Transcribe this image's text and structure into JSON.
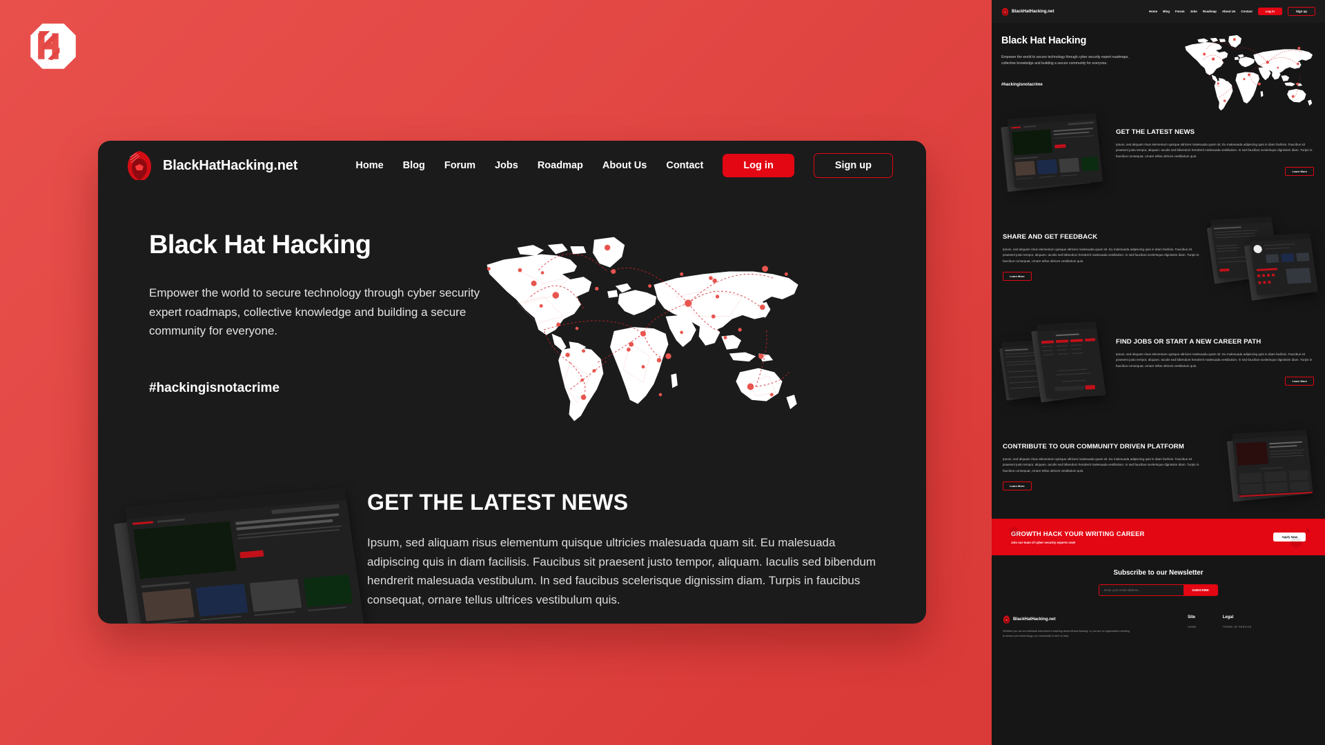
{
  "brand": {
    "logo_mark": "hh-monogram-logo",
    "name": "BlackHatHacking.net"
  },
  "nav": {
    "links": [
      "Home",
      "Blog",
      "Forum",
      "Jobs",
      "Roadmap",
      "About Us",
      "Contact"
    ],
    "login_label": "Log in",
    "signup_label": "Sign up"
  },
  "hero": {
    "title": "Black Hat Hacking",
    "subtitle": "Empower the world to secure technology through cyber security expert roadmaps, collective knowledge and building a secure community for everyone.",
    "hashtag": "#hackingisnotacrime",
    "map_alt": "world-connection-map"
  },
  "sections": [
    {
      "title": "GET THE LATEST NEWS",
      "body": "Ipsum, sed aliquam risus elementum quisque ultricies malesuada quam sit. Eu malesuada adipiscing quis in diam facilisis. Faucibus sit praesent justo tempor, aliquam. Iaculis sed bibendum hendrerit malesuada vestibulum. In sed faucibus scelerisque dignissim diam. Turpis in faucibus consequat, ornare tellus ultrices vestibulum quis.",
      "cta": "Learn More",
      "image_side": "left"
    },
    {
      "title": "SHARE AND GET FEEDBACK",
      "body": "Ipsum, sed aliquam risus elementum quisque ultricies malesuada quam sit. Eu malesuada adipiscing quis in diam facilisis. Faucibus sit praesent justo tempor, aliquam. Iaculis sed bibendum hendrerit malesuada vestibulum. In sed faucibus scelerisque dignissim diam. Turpis in faucibus consequat, ornare tellus ultrices vestibulum quis.",
      "cta": "Learn More",
      "image_side": "right"
    },
    {
      "title": "FIND JOBS OR START A NEW CAREER PATH",
      "body": "Ipsum, sed aliquam risus elementum quisque ultricies malesuada quam sit. Eu malesuada adipiscing quis in diam facilisis. Faucibus sit praesent justo tempor, aliquam. Iaculis sed bibendum hendrerit malesuada vestibulum. In sed faucibus scelerisque dignissim diam. Turpis in faucibus consequat, ornare tellus ultrices vestibulum quis.",
      "cta": "Learn More",
      "image_side": "left"
    },
    {
      "title": "CONTRIBUTE TO OUR COMMUNITY DRIVEN PLATFORM",
      "body": "Ipsum, sed aliquam risus elementum quisque ultricies malesuada quam sit. Eu malesuada adipiscing quis in diam facilisis. Faucibus sit praesent justo tempor, aliquam. Iaculis sed bibendum hendrerit malesuada vestibulum. In sed faucibus scelerisque dignissim diam. Turpis in faucibus consequat, ornare tellus ultrices vestibulum quis.",
      "cta": "Learn More",
      "image_side": "right"
    }
  ],
  "cta_banner": {
    "title": "GROWTH HACK YOUR WRITING CAREER",
    "subtitle": "Join our team of cyber security experts now!",
    "button": "Apply Now"
  },
  "newsletter": {
    "title": "Subscribe to our Newsletter",
    "placeholder": "Enter your email address...",
    "button": "SUBSCRIBE"
  },
  "footer": {
    "brand": "BlackHatHacking.net",
    "description": "Whether you are an individual interested in learning about ethical hacking, or you are an organization seeking to secure your technology, our community is here to help.",
    "columns": [
      {
        "heading": "Site",
        "items": [
          "HOME"
        ]
      },
      {
        "heading": "Legal",
        "items": [
          "TERMS OF SERVICE"
        ]
      }
    ]
  },
  "colors": {
    "accent_red": "#e30613",
    "page_bg_red": "#e04745",
    "card_bg": "#1b1b1b",
    "panel_bg": "#161616"
  }
}
